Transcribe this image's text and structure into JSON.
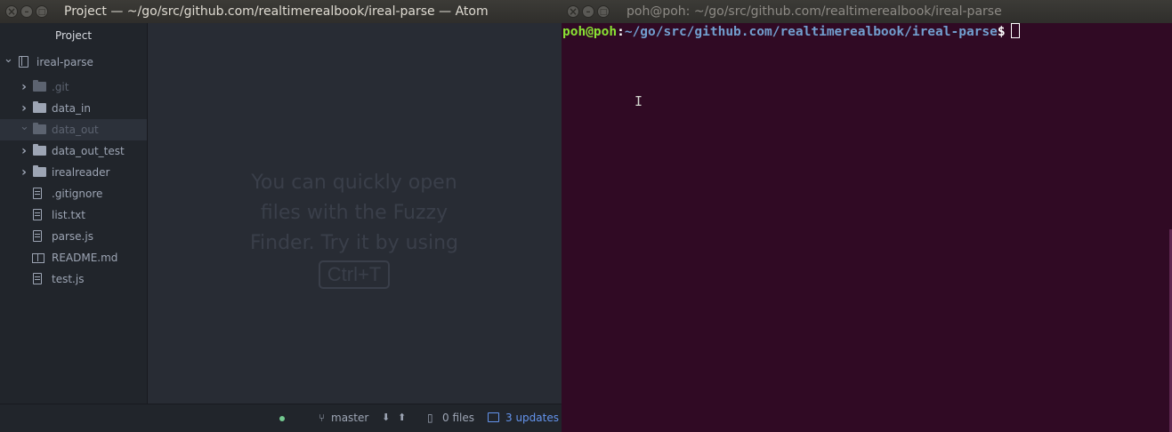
{
  "atom": {
    "title": "Project — ~/go/src/github.com/realtimerealbook/ireal-parse — Atom",
    "tree": {
      "header": "Project",
      "root": "ireal-parse",
      "items": [
        {
          "label": ".git",
          "kind": "folder",
          "icon": "folder-icon",
          "dim": true
        },
        {
          "label": "data_in",
          "kind": "folder",
          "icon": "folder-icon"
        },
        {
          "label": "data_out",
          "kind": "folder",
          "icon": "folder-icon",
          "dim": true,
          "expanded": true,
          "selected": true
        },
        {
          "label": "data_out_test",
          "kind": "folder",
          "icon": "folder-icon"
        },
        {
          "label": "irealreader",
          "kind": "folder",
          "icon": "folder-icon"
        },
        {
          "label": ".gitignore",
          "kind": "file",
          "icon": "file-text-icon"
        },
        {
          "label": "list.txt",
          "kind": "file",
          "icon": "file-text-icon"
        },
        {
          "label": "parse.js",
          "kind": "file",
          "icon": "file-text-icon"
        },
        {
          "label": "README.md",
          "kind": "file",
          "icon": "book-icon"
        },
        {
          "label": "test.js",
          "kind": "file",
          "icon": "file-text-icon"
        }
      ]
    },
    "editor": {
      "hint_lines": [
        "You can quickly open",
        "files with the Fuzzy",
        "Finder. Try it by using"
      ],
      "shortcut": "Ctrl+T"
    },
    "status": {
      "branch": "master",
      "files": "0 files",
      "updates": "3 updates",
      "accent": "#6494ed"
    }
  },
  "terminal": {
    "title": "poh@poh: ~/go/src/github.com/realtimerealbook/ireal-parse",
    "prompt_user": "poh@poh",
    "prompt_colon": ":",
    "prompt_path": "~/go/src/github.com/realtimerealbook/ireal-parse",
    "prompt_dollar": "$",
    "background": "#300a24"
  }
}
